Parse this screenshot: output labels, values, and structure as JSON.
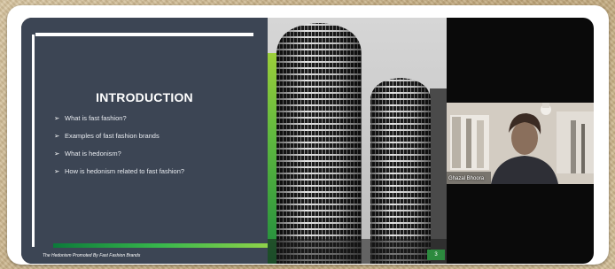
{
  "slide": {
    "title": "INTRODUCTION",
    "bullets": [
      {
        "marker": "➢",
        "text": "What is fast fashion?"
      },
      {
        "marker": "➢",
        "text": "Examples of fast fashion brands"
      },
      {
        "marker": "➢",
        "text": "What is hedonism?"
      },
      {
        "marker": "➢",
        "text": "How is hedonism related to fast fashion?"
      }
    ],
    "footer": "The Hedonism Promoted By Fast Fashion Brands",
    "page_number": "3"
  },
  "participant": {
    "name": "Ghazal Bhoora"
  },
  "colors": {
    "slide_bg": "#3c4554",
    "accent_green": "#38b84c",
    "frame": "#ffffff"
  }
}
